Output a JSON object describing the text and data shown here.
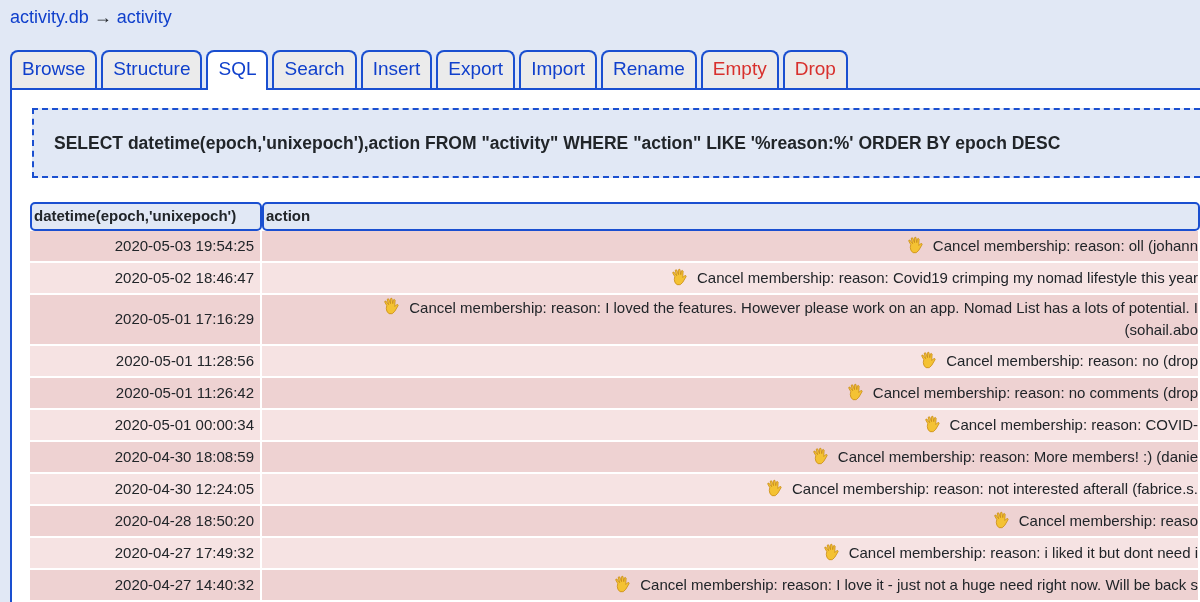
{
  "breadcrumb": {
    "database": "activity.db",
    "separator": "→",
    "table": "activity"
  },
  "tabs": [
    {
      "label": "Browse",
      "selected": false,
      "kind": "normal"
    },
    {
      "label": "Structure",
      "selected": false,
      "kind": "normal"
    },
    {
      "label": "SQL",
      "selected": true,
      "kind": "normal"
    },
    {
      "label": "Search",
      "selected": false,
      "kind": "normal"
    },
    {
      "label": "Insert",
      "selected": false,
      "kind": "normal"
    },
    {
      "label": "Export",
      "selected": false,
      "kind": "normal"
    },
    {
      "label": "Import",
      "selected": false,
      "kind": "normal"
    },
    {
      "label": "Rename",
      "selected": false,
      "kind": "normal"
    },
    {
      "label": "Empty",
      "selected": false,
      "kind": "danger"
    },
    {
      "label": "Drop",
      "selected": false,
      "kind": "danger"
    }
  ],
  "query": "SELECT datetime(epoch,'unixepoch'),action FROM \"activity\" WHERE \"action\" LIKE '%reason:%' ORDER BY epoch DESC",
  "table": {
    "columns": [
      "datetime(epoch,'unixepoch')",
      "action"
    ],
    "rows": [
      {
        "datetime": "2020-05-03 19:54:25",
        "action": [
          "Cancel membership: reason: oll (johann"
        ]
      },
      {
        "datetime": "2020-05-02 18:46:47",
        "action": [
          "Cancel membership: reason: Covid19 crimping my nomad lifestyle this year"
        ]
      },
      {
        "datetime": "2020-05-01 17:16:29",
        "action": [
          "Cancel membership: reason: I loved the features. However please work on an app. Nomad List has a lots of potential. I",
          "(sohail.abo"
        ]
      },
      {
        "datetime": "2020-05-01 11:28:56",
        "action": [
          "Cancel membership: reason: no (drop"
        ]
      },
      {
        "datetime": "2020-05-01 11:26:42",
        "action": [
          "Cancel membership: reason: no comments (drop"
        ]
      },
      {
        "datetime": "2020-05-01 00:00:34",
        "action": [
          "Cancel membership: reason: COVID-"
        ]
      },
      {
        "datetime": "2020-04-30 18:08:59",
        "action": [
          "Cancel membership: reason: More members! :) (danie"
        ]
      },
      {
        "datetime": "2020-04-30 12:24:05",
        "action": [
          "Cancel membership: reason: not interested afterall (fabrice.s."
        ]
      },
      {
        "datetime": "2020-04-28 18:50:20",
        "action": [
          "Cancel membership: reaso"
        ]
      },
      {
        "datetime": "2020-04-27 17:49:32",
        "action": [
          "Cancel membership: reason: i liked it but dont need i"
        ]
      },
      {
        "datetime": "2020-04-27 14:40:32",
        "action": [
          "Cancel membership: reason: I love it - just not a huge need right now. Will be back s"
        ]
      }
    ]
  }
}
